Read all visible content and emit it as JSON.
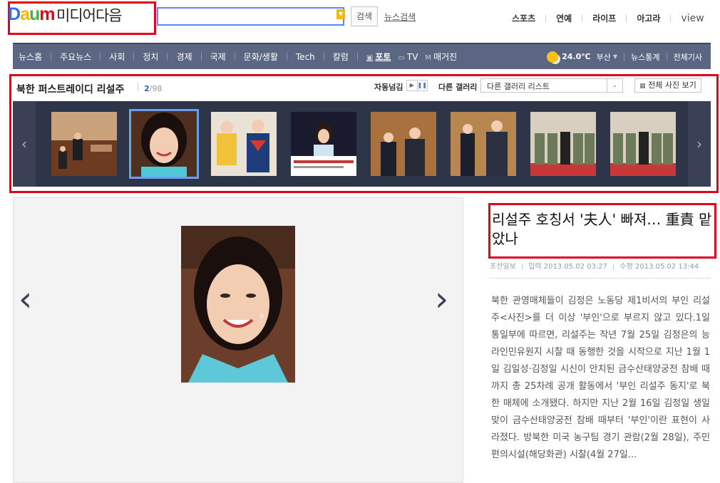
{
  "header": {
    "logo": {
      "letters": [
        "D",
        "a",
        "u",
        "m"
      ],
      "title": "미디어다음"
    },
    "search": {
      "value": "",
      "placeholder": "",
      "button_label": "검색",
      "news_search_label": "뉴스검색"
    },
    "top_menu": [
      "스포츠",
      "연예",
      "라이프",
      "아고라",
      "view"
    ]
  },
  "nav": {
    "items": [
      "뉴스홈",
      "주요뉴스",
      "사회",
      "정치",
      "경제",
      "국제",
      "문화/생활",
      "Tech",
      "칼럼"
    ],
    "media_items": [
      {
        "icon": "photo-icon",
        "label": "포토",
        "active": true
      },
      {
        "icon": "tv-icon",
        "label": "TV",
        "active": false
      },
      {
        "icon": "magazine-icon",
        "label": "매거진",
        "active": false
      }
    ],
    "weather": {
      "icon": "sun-cloud-icon",
      "temp": "24.0℃",
      "location": "부산"
    },
    "right_links": [
      "뉴스통계",
      "전체기사"
    ]
  },
  "gallery": {
    "title": "북한 퍼스트레이디 리설주",
    "current": "2",
    "total": "/98",
    "autoplay_label": "자동넘김",
    "autoplay_play": "▶",
    "autoplay_pause": "❚❚",
    "other_gallery_label": "다른 갤러리",
    "other_gallery_select": "다른 갤러리 리스트",
    "view_all_label": "전체 사진 보기",
    "selected_index": 1,
    "thumbnail_count": 8
  },
  "article": {
    "headline": "리설주 호칭서 '夫人' 빠져… 重責 맡았나",
    "source": "조선일보",
    "input_time": "입력 2013.05.02 03:27",
    "edit_time": "수정 2013.05.02 13:44",
    "body": "북한 관영매체들이 김정은 노동당 제1비서의 부인 리설주<사진>를 더 이상 '부인'으로 부르지 않고 있다.1일 통일부에 따르면, 리설주는 작년 7월 25일 김정은의 능라인민유원지 시찰 때 동행한 것을 시작으로 지난 1월 1일 김일성·김정일 시신이 안치된 금수산태양궁전 참배 때까지 총 25차례 공개 활동에서 '부인 리설주 동지'로 북한 매체에 소개됐다. 하지만 지난 2월 16일 김정일 생일맞이 금수산태양궁전 참배 때부터 '부인'이란 표현이 사라졌다. 방북한 미국 농구팀 경기 관람(2월 28일), 주민편의시설(해당화관) 시찰(4월 27일..."
  },
  "colors": {
    "nav_bg": "#5b6782",
    "highlight_red": "#e3001b",
    "strip_bg": "#2f3548",
    "accent_blue": "#2b64c7"
  }
}
